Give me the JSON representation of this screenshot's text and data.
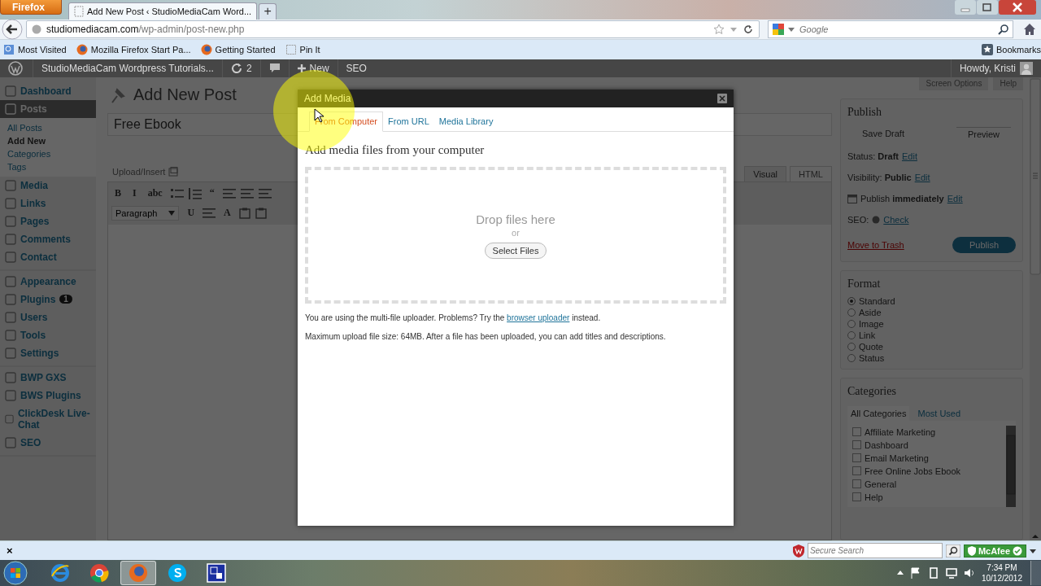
{
  "browser": {
    "menu_button": "Firefox",
    "tabs": [
      {
        "title": "Add New Post ‹ StudioMediaCam Word...",
        "selected": true
      }
    ],
    "new_tab": "+",
    "url": {
      "host": "studiomediacam.com",
      "path": "/wp-admin/post-new.php"
    },
    "search": {
      "placeholder": "Google"
    },
    "bookmarks": [
      {
        "label": "Most Visited",
        "kind": "folder"
      },
      {
        "label": "Mozilla Firefox Start Pa...",
        "kind": "firefox"
      },
      {
        "label": "Getting Started",
        "kind": "firefox"
      },
      {
        "label": "Pin It",
        "kind": "page"
      }
    ],
    "bookmarks_menu": "Bookmarks"
  },
  "admin_bar": {
    "site": "StudioMediaCam Wordpress Tutorials...",
    "updates": "2",
    "new": "New",
    "seo": "SEO",
    "greeting": "Howdy, Kristi"
  },
  "sidebar": {
    "groups": [
      {
        "items": [
          {
            "label": "Dashboard",
            "selected": false
          },
          {
            "label": "Posts",
            "selected": true,
            "children": [
              {
                "label": "All Posts",
                "selected": false
              },
              {
                "label": "Add New",
                "selected": true
              },
              {
                "label": "Categories",
                "selected": false
              },
              {
                "label": "Tags",
                "selected": false
              }
            ]
          },
          {
            "label": "Media",
            "selected": false
          },
          {
            "label": "Links",
            "selected": false
          },
          {
            "label": "Pages",
            "selected": false
          },
          {
            "label": "Comments",
            "selected": false
          },
          {
            "label": "Contact",
            "selected": false
          }
        ]
      },
      {
        "items": [
          {
            "label": "Appearance",
            "selected": false
          },
          {
            "label": "Plugins",
            "selected": false,
            "badge": "1"
          },
          {
            "label": "Users",
            "selected": false
          },
          {
            "label": "Tools",
            "selected": false
          },
          {
            "label": "Settings",
            "selected": false
          }
        ]
      },
      {
        "items": [
          {
            "label": "BWP GXS",
            "selected": false
          },
          {
            "label": "BWS Plugins",
            "selected": false
          },
          {
            "label": "ClickDesk Live-Chat",
            "selected": false
          },
          {
            "label": "SEO",
            "selected": false
          }
        ]
      }
    ]
  },
  "editor": {
    "title": "Add New Post",
    "post_title": "Free Ebook",
    "upload_label": "Upload/Insert",
    "modes": [
      {
        "label": "Visual",
        "selected": true
      },
      {
        "label": "HTML",
        "selected": false
      }
    ],
    "toolbar": [
      [
        {
          "kind": "char",
          "label": "B"
        },
        {
          "kind": "char",
          "label": "I"
        },
        {
          "kind": "char",
          "label": "abc"
        },
        {
          "kind": "bullets"
        },
        {
          "kind": "numbers"
        },
        {
          "kind": "char",
          "label": "“"
        },
        {
          "kind": "align"
        },
        {
          "kind": "align"
        },
        {
          "kind": "align"
        }
      ],
      [
        {
          "kind": "select",
          "label": "Paragraph"
        },
        {
          "kind": "char",
          "label": "U"
        },
        {
          "kind": "align"
        },
        {
          "kind": "char",
          "label": "A"
        },
        {
          "kind": "paste"
        },
        {
          "kind": "paste"
        }
      ]
    ]
  },
  "screen_options": "Screen Options",
  "help": "Help",
  "publish": {
    "title": "Publish",
    "save_draft": "Save Draft",
    "preview": "Preview",
    "rows": [
      {
        "kind": "plain",
        "label": "Status:",
        "value": "Draft",
        "link": "Edit"
      },
      {
        "kind": "plain",
        "label": "Visibility:",
        "value": "Public",
        "link": "Edit"
      },
      {
        "kind": "calendar",
        "label": "Publish",
        "value": "immediately",
        "link": "Edit"
      },
      {
        "kind": "dot",
        "label": "SEO:",
        "link": "Check"
      }
    ],
    "trash": "Move to Trash",
    "button": "Publish"
  },
  "format": {
    "title": "Format",
    "options": [
      {
        "label": "Standard",
        "selected": true
      },
      {
        "label": "Aside",
        "selected": false
      },
      {
        "label": "Image",
        "selected": false
      },
      {
        "label": "Link",
        "selected": false
      },
      {
        "label": "Quote",
        "selected": false
      },
      {
        "label": "Status",
        "selected": false
      }
    ]
  },
  "categories": {
    "title": "Categories",
    "tabs": [
      {
        "label": "All Categories",
        "selected": true
      },
      {
        "label": "Most Used",
        "selected": false
      }
    ],
    "items": [
      {
        "label": "Affiliate Marketing",
        "checked": false
      },
      {
        "label": "Dashboard",
        "checked": false
      },
      {
        "label": "Email Marketing",
        "checked": false
      },
      {
        "label": "Free Online Jobs Ebook",
        "checked": false
      },
      {
        "label": "General",
        "checked": false
      },
      {
        "label": "Help",
        "checked": false
      }
    ]
  },
  "modal": {
    "title": "Add Media",
    "tabs": [
      {
        "label": "From Computer",
        "selected": true
      },
      {
        "label": "From URL",
        "selected": false
      },
      {
        "label": "Media Library",
        "selected": false
      }
    ],
    "heading": "Add media files from your computer",
    "drop_text": "Drop files here",
    "or": "or",
    "select_button": "Select Files",
    "note": {
      "before": "You are using the multi-file uploader. Problems? Try the",
      "link": "browser uploader",
      "after": "instead."
    },
    "limit": "Maximum upload file size: 64MB. After a file has been uploaded, you can add titles and descriptions."
  },
  "addon_bar": {
    "close": "×",
    "search_placeholder": "Secure Search",
    "security": "McAfee"
  },
  "taskbar": {
    "apps": [
      {
        "kind": "ie",
        "selected": false
      },
      {
        "kind": "chrome",
        "selected": false
      },
      {
        "kind": "firefox",
        "selected": true
      },
      {
        "kind": "skype",
        "selected": false
      },
      {
        "kind": "app",
        "selected": false
      }
    ],
    "time": "7:34 PM",
    "date": "10/12/2012"
  }
}
